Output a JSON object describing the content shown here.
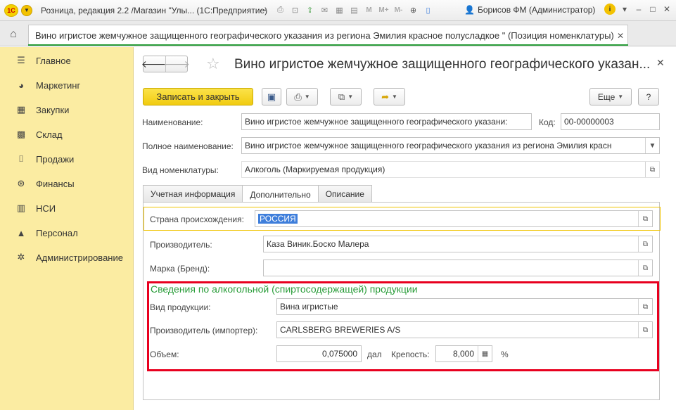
{
  "window": {
    "logo": "1С",
    "title": "Розница, редакция 2.2 /Магазин \"Улы...   (1С:Предприятие)",
    "user": "Борисов ФМ (Администратор)",
    "toolbar_icons": [
      "save-icon",
      "print-icon",
      "preview-icon",
      "upload-icon",
      "mail-icon",
      "calculator-icon",
      "calendar-icon",
      "m-icon",
      "m-plus-icon",
      "m-minus-icon",
      "zoom-icon",
      "panel-icon"
    ],
    "m_labels": [
      "M",
      "M+",
      "M-"
    ]
  },
  "tab": {
    "label": "Вино игристое жемчужное защищенного географического указания из региона Эмилия красное полусладкое \" (Позиция номенклатуры)"
  },
  "sidebar": {
    "items": [
      {
        "label": "Главное",
        "icon": "menu-icon"
      },
      {
        "label": "Маркетинг",
        "icon": "pie-chart-icon"
      },
      {
        "label": "Закупки",
        "icon": "cart-icon"
      },
      {
        "label": "Склад",
        "icon": "warehouse-icon"
      },
      {
        "label": "Продажи",
        "icon": "basket-icon"
      },
      {
        "label": "Финансы",
        "icon": "coin-icon"
      },
      {
        "label": "НСИ",
        "icon": "catalog-icon"
      },
      {
        "label": "Персонал",
        "icon": "person-icon"
      },
      {
        "label": "Администрирование",
        "icon": "gear-icon"
      }
    ]
  },
  "form": {
    "title": "Вино игристое жемчужное защищенного географического указан...",
    "buttons": {
      "save_close": "Записать и закрыть",
      "more": "Еще",
      "help": "?"
    },
    "fields": {
      "name_label": "Наименование:",
      "name_value": "Вино игристое жемчужное защищенного географического указани:",
      "code_label": "Код:",
      "code_value": "00-00000003",
      "full_name_label": "Полное наименование:",
      "full_name_value": "Вино игристое жемчужное защищенного географического указания из региона Эмилия красн",
      "kind_label": "Вид номенклатуры:",
      "kind_value": "Алкоголь (Маркируемая продукция)"
    },
    "tabs": [
      "Учетная информация",
      "Дополнительно",
      "Описание"
    ],
    "active_tab": "Дополнительно",
    "extra": {
      "country_label": "Страна происхождения:",
      "country_value": "РОССИЯ",
      "producer_label": "Производитель:",
      "producer_value": "Каза Виник.Боско Малера",
      "brand_label": "Марка (Бренд):",
      "brand_value": ""
    },
    "alcohol": {
      "title": "Сведения по алкогольной (спиртосодержащей) продукции",
      "product_kind_label": "Вид продукции:",
      "product_kind_value": "Вина игристые",
      "importer_label": "Производитель (импортер):",
      "importer_value": "CARLSBERG BREWERIES A/S",
      "volume_label": "Объем:",
      "volume_value": "0,075000",
      "volume_unit": "дал",
      "strength_label": "Крепость:",
      "strength_value": "8,000",
      "strength_unit": "%"
    }
  },
  "colors": {
    "sidebar_bg": "#fbeca2",
    "primary_button": "#f1cb10",
    "accent_green": "#2a9d3a",
    "highlight_red": "#e8001f",
    "selection_blue": "#3e7edb"
  }
}
